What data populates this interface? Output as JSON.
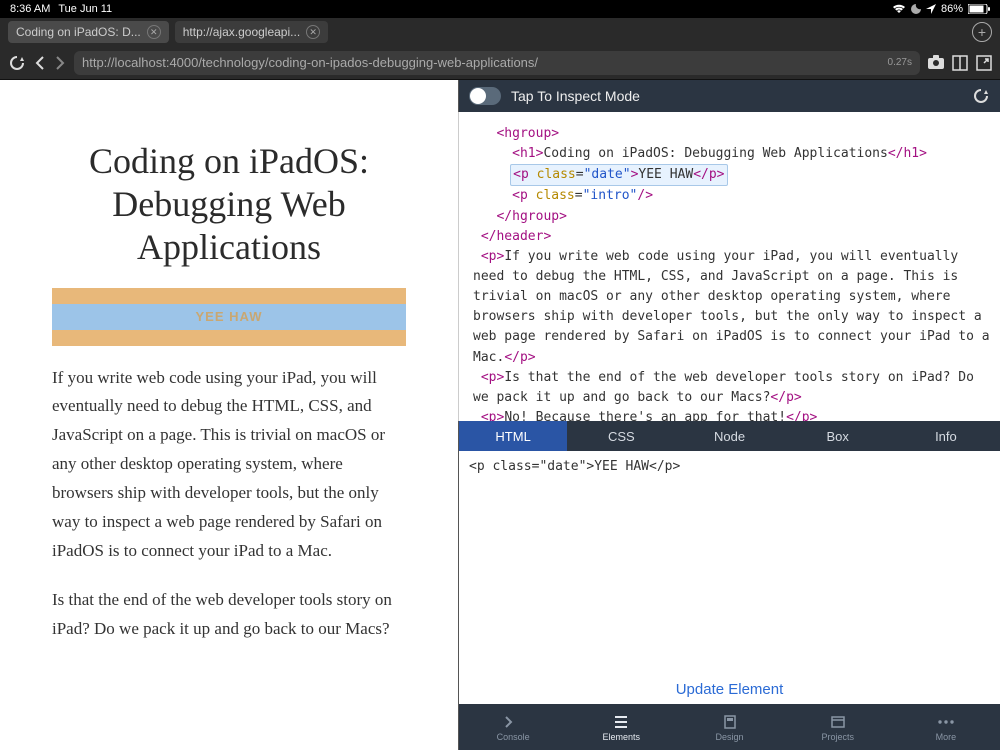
{
  "status": {
    "time": "8:36 AM",
    "date": "Tue Jun 11",
    "battery": "86%"
  },
  "tabs": {
    "items": [
      {
        "title": "Coding on iPadOS: D..."
      },
      {
        "title": "http://ajax.googleapi..."
      }
    ]
  },
  "url": {
    "value": "http://localhost:4000/technology/coding-on-ipados-debugging-web-applications/",
    "timing": "0.27s"
  },
  "page": {
    "title": "Coding on iPadOS: Debugging Web Applications",
    "date_label": "YEE HAW",
    "p1": "If you write web code using your iPad, you will eventually need to debug the HTML, CSS, and JavaScript on a page. This is trivial on macOS or any other desktop operating system, where browsers ship with developer tools, but the only way to inspect a web page rendered by Safari on iPadOS is to connect your iPad to a Mac.",
    "p2": "Is that the end of the web developer tools story on iPad? Do we pack it up and go back to our Macs?"
  },
  "inspect": {
    "label": "Tap To Inspect Mode"
  },
  "dom": {
    "hgroup_open": "<hgroup>",
    "h1_open": "<h1>",
    "h1_text": "Coding on iPadOS: Debugging Web Applications",
    "h1_close": "</h1>",
    "p_date_open": "<p class=\"date\">",
    "p_date_text": "YEE HAW",
    "p_date_close": "</p>",
    "p_intro": "<p class=\"intro\"/>",
    "hgroup_close": "</hgroup>",
    "header_close": "</header>",
    "p_body1": "If you write web code using your iPad, you will eventually need to debug the HTML, CSS, and JavaScript on a page. This is trivial on macOS or any other desktop operating system, where browsers ship with developer tools, but the only way to inspect a web page rendered by Safari on iPadOS is to connect your iPad to a Mac.",
    "p_body2": "Is that the end of the web developer tools story on iPad? Do we pack it up and go back to our Macs?",
    "p_body3": "No! Because there's an app for that!"
  },
  "devtabs": {
    "items": [
      "HTML",
      "CSS",
      "Node",
      "Box",
      "Info"
    ]
  },
  "detail": {
    "html": "<p class=\"date\">YEE HAW</p>"
  },
  "update": {
    "label": "Update Element"
  },
  "bottomnav": {
    "items": [
      "Console",
      "Elements",
      "Design",
      "Projects",
      "More"
    ]
  }
}
